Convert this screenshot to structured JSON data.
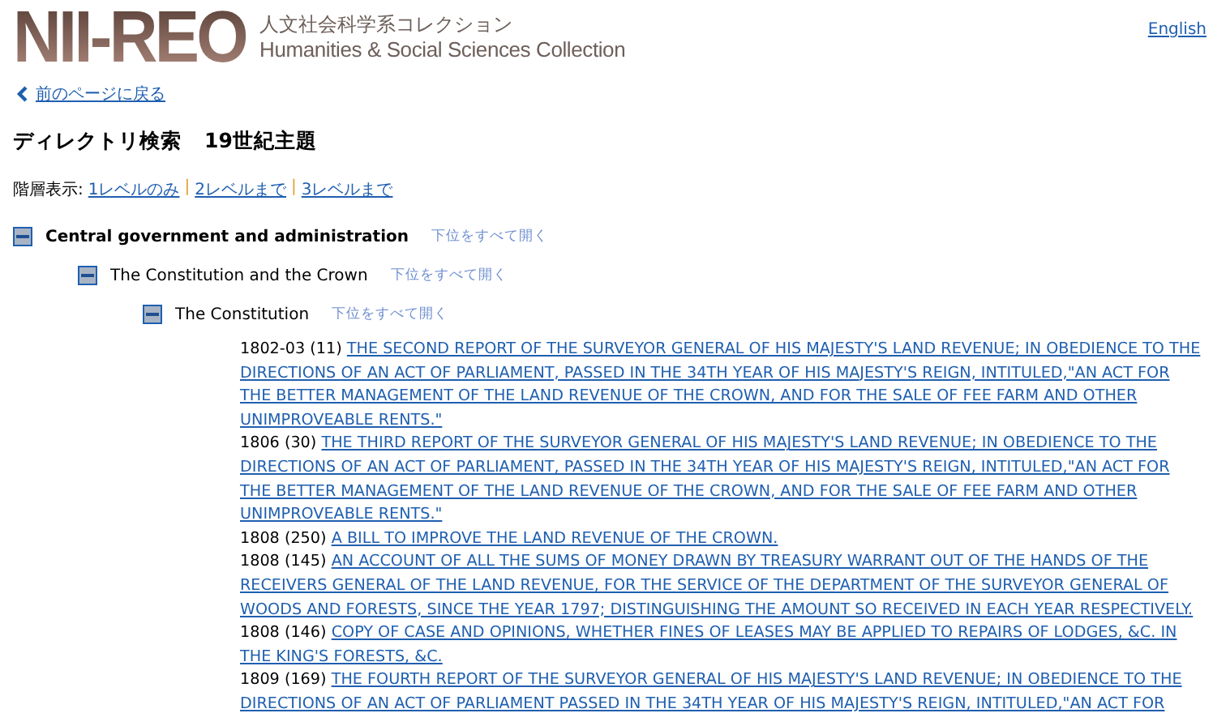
{
  "header": {
    "logo": "NII-REO",
    "subtitle_ja": "人文社会科学系コレクション",
    "subtitle_en": "Humanities & Social Sciences Collection",
    "language_link": "English"
  },
  "back_link": "前のページに戻る",
  "heading": {
    "label": "ディレクトリ検索",
    "title": "19世紀主題"
  },
  "level_view": {
    "label": "階層表示:",
    "separator": "|",
    "links": [
      "1レベルのみ",
      "2レベルまで",
      "3レベルまで"
    ]
  },
  "tree": [
    {
      "label": "Central government and administration",
      "expand_all": "下位をすべて開く",
      "expanded": true,
      "children": [
        {
          "label": "The Constitution and the Crown",
          "expand_all": "下位をすべて開く",
          "expanded": true,
          "children": [
            {
              "label": "The Constitution",
              "expand_all": "下位をすべて開く",
              "expanded": true,
              "entries": [
                {
                  "ref": "1802-03 (11)",
                  "title": "THE SECOND REPORT OF THE SURVEYOR GENERAL OF HIS MAJESTY'S LAND REVENUE; IN OBEDIENCE TO THE DIRECTIONS OF AN ACT OF PARLIAMENT, PASSED IN THE 34TH YEAR OF HIS MAJESTY'S REIGN, INTITULED,\"AN ACT FOR THE BETTER MANAGEMENT OF THE LAND REVENUE OF THE CROWN, AND FOR THE SALE OF FEE FARM AND OTHER UNIMPROVEABLE RENTS.\""
                },
                {
                  "ref": "1806 (30)",
                  "title": "THE THIRD REPORT OF THE SURVEYOR GENERAL OF HIS MAJESTY'S LAND REVENUE; IN OBEDIENCE TO THE DIRECTIONS OF AN ACT OF PARLIAMENT, PASSED IN THE 34TH YEAR OF HIS MAJESTY'S REIGN, INTITULED,\"AN ACT FOR THE BETTER MANAGEMENT OF THE LAND REVENUE OF THE CROWN, AND FOR THE SALE OF FEE FARM AND OTHER UNIMPROVEABLE RENTS.\""
                },
                {
                  "ref": "1808 (250)",
                  "title": "A BILL TO IMPROVE THE LAND REVENUE OF THE CROWN."
                },
                {
                  "ref": "1808 (145)",
                  "title": "AN ACCOUNT OF ALL THE SUMS OF MONEY DRAWN BY TREASURY WARRANT OUT OF THE HANDS OF THE RECEIVERS GENERAL OF THE LAND REVENUE, FOR THE SERVICE OF THE DEPARTMENT OF THE SURVEYOR GENERAL OF WOODS AND FORESTS, SINCE THE YEAR 1797; DISTINGUISHING THE AMOUNT SO RECEIVED IN EACH YEAR RESPECTIVELY."
                },
                {
                  "ref": "1808 (146)",
                  "title": "COPY OF CASE AND OPINIONS, WHETHER FINES OF LEASES MAY BE APPLIED TO REPAIRS OF LODGES, &C. IN THE KING'S FORESTS, &C."
                },
                {
                  "ref": "1809 (169)",
                  "title": "THE FOURTH REPORT OF THE SURVEYOR GENERAL OF HIS MAJESTY'S LAND REVENUE; IN OBEDIENCE TO THE DIRECTIONS OF AN ACT OF PARLIAMENT PASSED IN THE 34TH YEAR OF HIS MAJESTY'S REIGN, INTITULED,\"AN ACT FOR"
                }
              ]
            }
          ]
        }
      ]
    }
  ]
}
